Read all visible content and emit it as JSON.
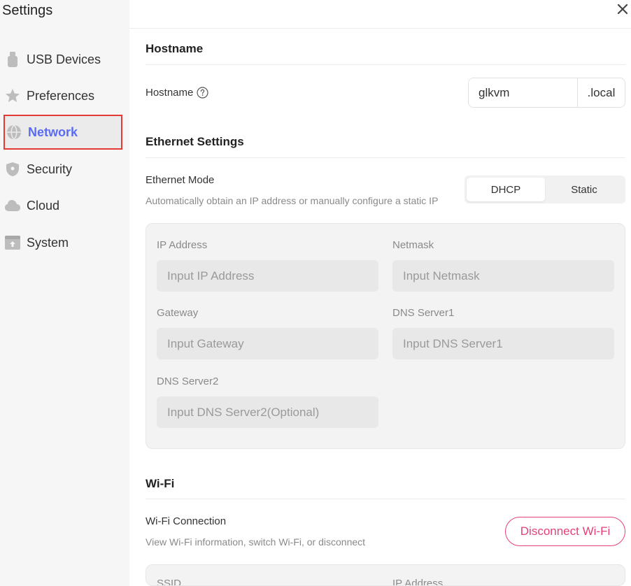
{
  "sidebar": {
    "title": "Settings",
    "items": [
      {
        "label": "USB Devices",
        "icon": "usb-icon"
      },
      {
        "label": "Preferences",
        "icon": "star-icon"
      },
      {
        "label": "Network",
        "icon": "globe-icon",
        "active": true
      },
      {
        "label": "Security",
        "icon": "shield-icon"
      },
      {
        "label": "Cloud",
        "icon": "cloud-icon"
      },
      {
        "label": "System",
        "icon": "system-icon"
      }
    ]
  },
  "hostname": {
    "section_title": "Hostname",
    "label": "Hostname",
    "value": "glkvm",
    "suffix": ".local"
  },
  "ethernet": {
    "section_title": "Ethernet Settings",
    "mode_label": "Ethernet Mode",
    "mode_desc": "Automatically obtain an IP address or manually configure a static IP",
    "modes": [
      "DHCP",
      "Static"
    ],
    "selected_mode": "DHCP",
    "fields": {
      "ip": {
        "label": "IP Address",
        "placeholder": "Input IP Address"
      },
      "netmask": {
        "label": "Netmask",
        "placeholder": "Input Netmask"
      },
      "gateway": {
        "label": "Gateway",
        "placeholder": "Input Gateway"
      },
      "dns1": {
        "label": "DNS Server1",
        "placeholder": "Input DNS Server1"
      },
      "dns2": {
        "label": "DNS Server2",
        "placeholder": "Input DNS Server2(Optional)"
      }
    }
  },
  "wifi": {
    "section_title": "Wi-Fi",
    "conn_label": "Wi-Fi Connection",
    "conn_desc": "View Wi-Fi information, switch Wi-Fi, or disconnect",
    "disconnect_label": "Disconnect Wi-Fi",
    "ssid_label": "SSID",
    "ip_label": "IP Address"
  },
  "colors": {
    "accent": "#5b6cf0",
    "danger": "#e5407a",
    "highlight_border": "#e53935"
  }
}
